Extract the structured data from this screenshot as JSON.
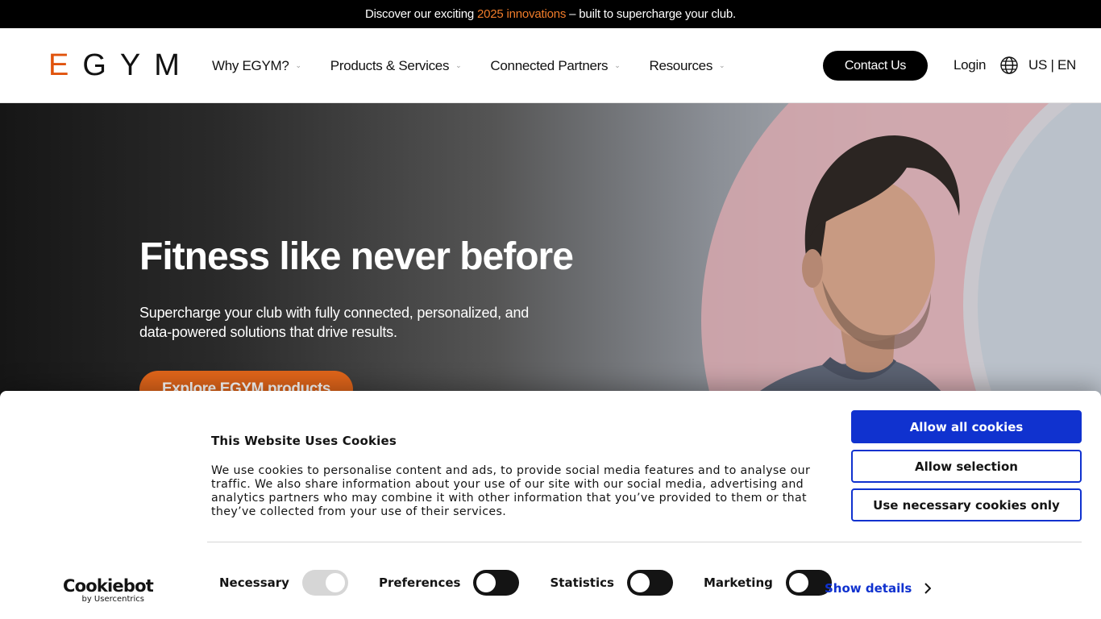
{
  "announcement": {
    "prefix": "Discover our exciting ",
    "highlight": "2025 innovations",
    "suffix": " – built to supercharge your club.",
    "accent_color": "#f07c2a"
  },
  "header": {
    "logo_letters": [
      "E",
      "G",
      "Y",
      "M"
    ],
    "nav": [
      {
        "label": "Why EGYM?"
      },
      {
        "label": "Products & Services"
      },
      {
        "label": "Connected Partners"
      },
      {
        "label": "Resources"
      }
    ],
    "contact_label": "Contact Us",
    "login_label": "Login",
    "locale_label": "US | EN",
    "brand_color": "#e0530c"
  },
  "hero": {
    "title": "Fitness like never before",
    "subtitle": "Supercharge your club with fully connected, personalized, and data-powered solutions that drive results.",
    "cta_label": "Explore EGYM products",
    "cta_color": "#e0651a"
  },
  "cookie_banner": {
    "title": "This Website Uses Cookies",
    "text": "We use cookies to personalise content and ads, to provide social media features and to analyse our traffic. We also share information about your use of our site with our social media, advertising and analytics partners who may combine it with other information that you’ve provided to them or that they’ve collected from your use of their services.",
    "buttons": {
      "allow_all": "Allow all cookies",
      "allow_selection": "Allow selection",
      "necessary_only": "Use necessary cookies only"
    },
    "logo_main": "Cookiebot",
    "logo_sub": "by Usercentrics",
    "toggles": [
      {
        "label": "Necessary",
        "state": "on",
        "disabled": true
      },
      {
        "label": "Preferences",
        "state": "off"
      },
      {
        "label": "Statistics",
        "state": "off"
      },
      {
        "label": "Marketing",
        "state": "off"
      }
    ],
    "show_details_label": "Show details",
    "accent_color": "#1032cf"
  }
}
